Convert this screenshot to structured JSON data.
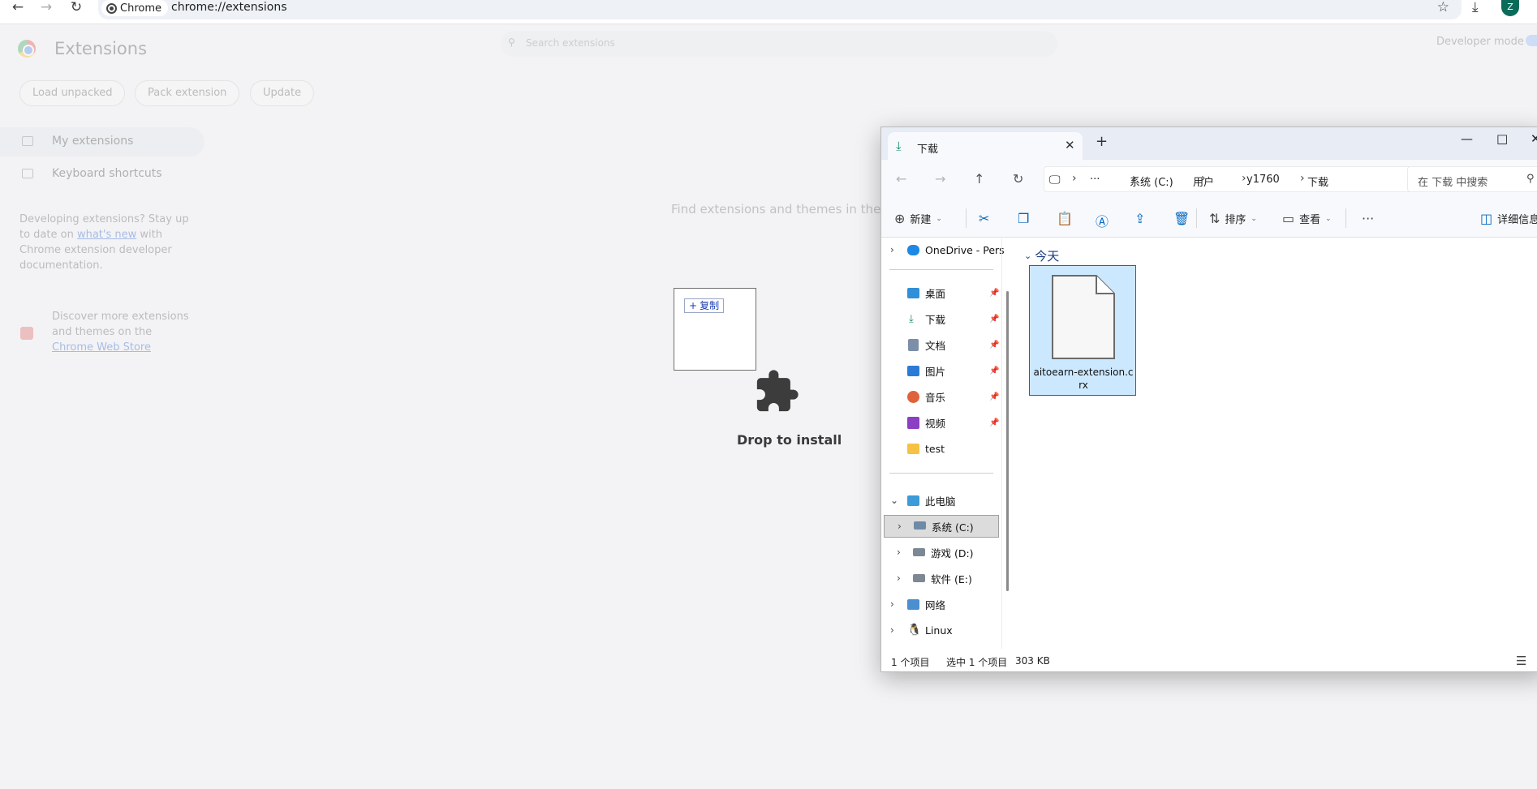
{
  "browser": {
    "site_chip": "Chrome",
    "url": "chrome://extensions",
    "avatar_letter": "Z"
  },
  "extensions_page": {
    "title": "Extensions",
    "search_placeholder": "Search extensions",
    "developer_mode_label": "Developer mode",
    "actions": [
      "Load unpacked",
      "Pack extension",
      "Update"
    ],
    "nav": {
      "my_extensions": "My extensions",
      "keyboard_shortcuts": "Keyboard shortcuts"
    },
    "promo": {
      "line1": "Developing extensions? Stay up to date on",
      "link": "what's new",
      "line2": "with Chrome extension developer documentation."
    },
    "discover": {
      "text": "Discover more extensions and themes on the",
      "link": "Chrome Web Store"
    },
    "empty_hint": "Find extensions and themes in the C"
  },
  "drop_overlay": {
    "copy_badge": "复制",
    "drop_label": "Drop to install"
  },
  "explorer": {
    "tab_label": "下载",
    "breadcrumbs": [
      "系统 (C:)",
      "用户",
      "y1760",
      "下载"
    ],
    "search_placeholder": "在 下载 中搜索",
    "commands": {
      "new": "新建",
      "sort": "排序",
      "view": "查看",
      "details": "详细信息"
    },
    "nav": {
      "onedrive": "OneDrive - Pers",
      "desktop": "桌面",
      "downloads": "下载",
      "documents": "文档",
      "pictures": "图片",
      "music": "音乐",
      "videos": "视频",
      "test": "test",
      "this_pc": "此电脑",
      "drive_c": "系统 (C:)",
      "drive_d": "游戏 (D:)",
      "drive_e": "软件 (E:)",
      "network": "网络",
      "linux": "Linux"
    },
    "group_label": "今天",
    "file_name": "aitoearn-extension.crx",
    "status": {
      "count": "1 个项目",
      "selected": "选中 1 个项目",
      "size": "303 KB"
    }
  }
}
